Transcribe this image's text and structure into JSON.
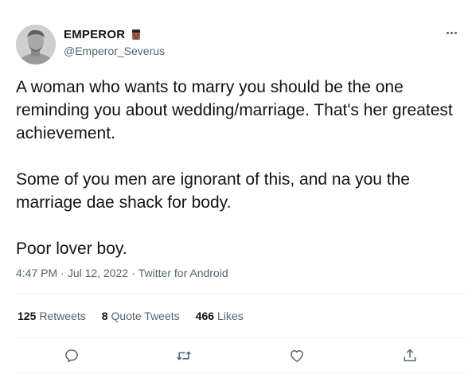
{
  "author": {
    "display_name": "EMPEROR",
    "handle": "@Emperor_Severus",
    "badge_icon": "face-emoji-icon"
  },
  "tweet": {
    "paragraphs": [
      "A woman who wants to marry you should be the one reminding you about wedding/marriage. That's her greatest achievement.",
      "Some of you men are ignorant of this, and na you the marriage dae shack for body.",
      "Poor lover boy."
    ],
    "time": "4:47 PM",
    "date": "Jul 12, 2022",
    "source": "Twitter for Android",
    "separator": "·"
  },
  "stats": {
    "retweets_count": "125",
    "retweets_label": "Retweets",
    "quotes_count": "8",
    "quotes_label": "Quote Tweets",
    "likes_count": "466",
    "likes_label": "Likes"
  },
  "actions": [
    "reply-icon",
    "retweet-icon",
    "like-icon",
    "share-icon"
  ],
  "colors": {
    "text": "#0f1419",
    "secondary": "#536471",
    "divider": "#eff3f4"
  }
}
